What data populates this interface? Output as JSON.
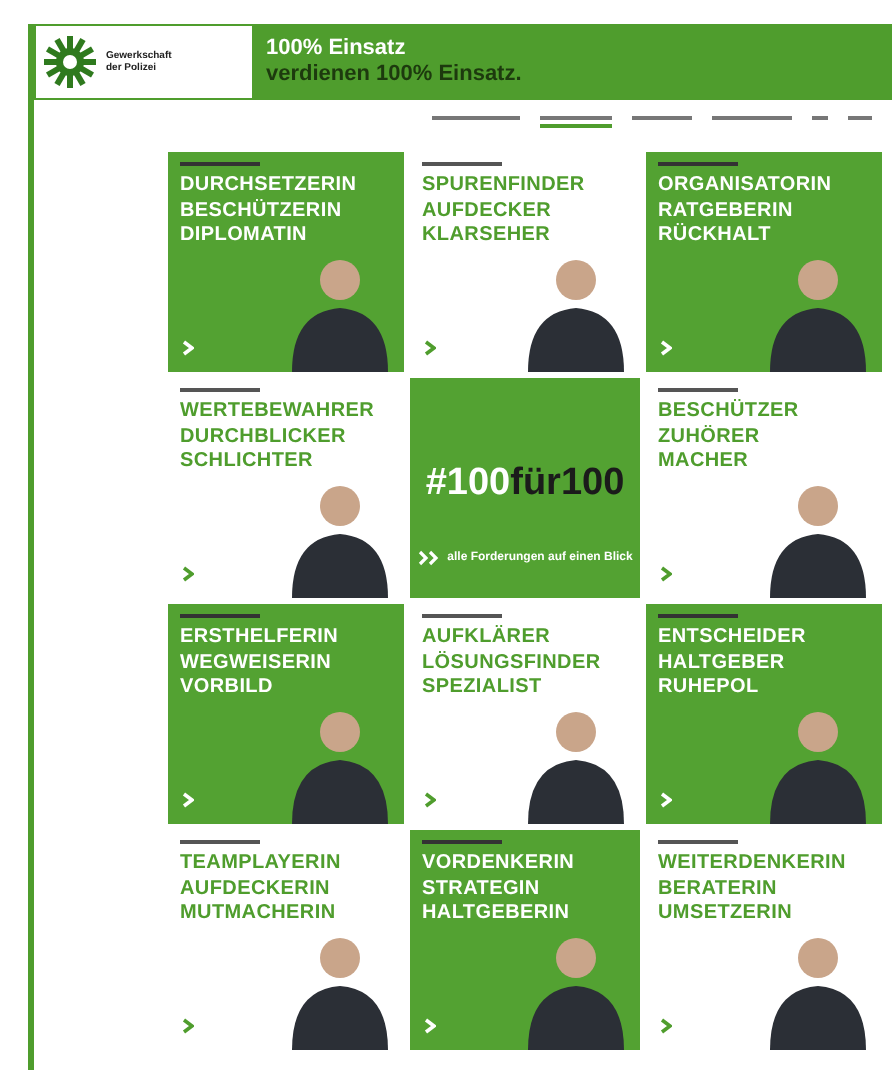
{
  "header": {
    "logo_text": [
      "Gewerkschaft",
      "der Polizei"
    ],
    "headline": "100% Einsatz",
    "subline": "verdienen 100% Einsatz."
  },
  "nav": [
    {
      "selected": false
    },
    {
      "selected": true
    },
    {
      "selected": false
    },
    {
      "selected": false
    },
    {
      "selected": false
    },
    {
      "selected": false
    }
  ],
  "center_tile": {
    "hashtag": [
      {
        "text": "#100",
        "kind": "light"
      },
      {
        "text": "für100",
        "kind": "dark"
      }
    ],
    "link": "alle Forderungen auf einen Blick"
  },
  "cards": [
    {
      "kind": "green",
      "title": [
        "DURCHSETZERIN",
        "BESCHÜTZERIN",
        "DIPLOMATIN"
      ]
    },
    {
      "kind": "white",
      "title": [
        "SPURENFINDER",
        "AUFDECKER",
        "KLARSEHER"
      ]
    },
    {
      "kind": "green",
      "title": [
        "ORGANISATORIN",
        "RATGEBERIN",
        "RÜCKHALT"
      ]
    },
    {
      "kind": "white",
      "title": [
        "WERTEBEWAHRER",
        "DURCHBLICKER",
        "SCHLICHTER"
      ]
    },
    {
      "kind": "white",
      "title": [
        "BESCHÜTZER",
        "ZUHÖRER",
        "MACHER"
      ]
    },
    {
      "kind": "green",
      "title": [
        "ERSTHELFERIN",
        "WEGWEISERIN",
        "VORBILD"
      ]
    },
    {
      "kind": "white",
      "title": [
        "AUFKLÄRER",
        "LÖSUNGSFINDER",
        "SPEZIALIST"
      ]
    },
    {
      "kind": "green",
      "title": [
        "ENTSCHEIDER",
        "HALTGEBER",
        "RUHEPOL"
      ]
    },
    {
      "kind": "white",
      "title": [
        "TEAMPLAYERIN",
        "AUFDECKERIN",
        "MUTMACHERIN"
      ]
    },
    {
      "kind": "green",
      "title": [
        "VORDENKERIN",
        "STRATEGIN",
        "HALTGEBERIN"
      ]
    },
    {
      "kind": "white",
      "title": [
        "WEITERDENKERIN",
        "BERATERIN",
        "UMSETZERIN"
      ]
    }
  ]
}
